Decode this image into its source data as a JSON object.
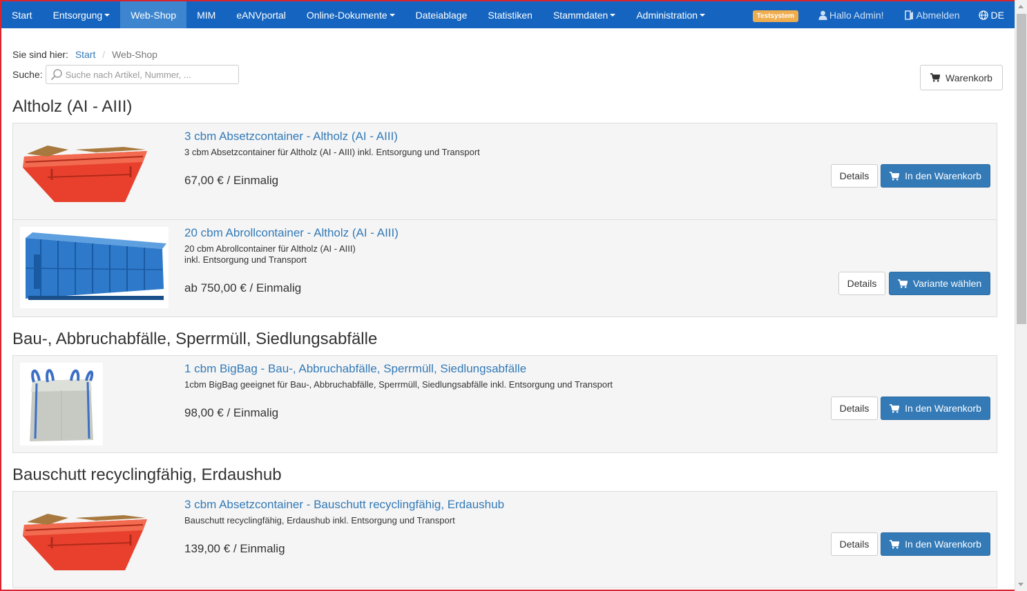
{
  "nav": {
    "items": [
      {
        "label": "Start",
        "dropdown": false,
        "active": false
      },
      {
        "label": "Entsorgung",
        "dropdown": true,
        "active": false
      },
      {
        "label": "Web-Shop",
        "dropdown": false,
        "active": true
      },
      {
        "label": "MIM",
        "dropdown": false,
        "active": false
      },
      {
        "label": "eANVportal",
        "dropdown": false,
        "active": false
      },
      {
        "label": "Online-Dokumente",
        "dropdown": true,
        "active": false
      },
      {
        "label": "Dateiablage",
        "dropdown": false,
        "active": false
      },
      {
        "label": "Statistiken",
        "dropdown": false,
        "active": false
      },
      {
        "label": "Stammdaten",
        "dropdown": true,
        "active": false
      },
      {
        "label": "Administration",
        "dropdown": true,
        "active": false
      }
    ],
    "badge": "Testsystem",
    "user": "Hallo Admin!",
    "logout": "Abmelden",
    "language": "DE"
  },
  "breadcrumb": {
    "prefix": "Sie sind hier:",
    "items": [
      "Start",
      "Web-Shop"
    ]
  },
  "search": {
    "label": "Suche:",
    "placeholder": "Suche nach Artikel, Nummer, ..."
  },
  "cart_button": "Warenkorb",
  "categories": [
    {
      "title": "Altholz (AI - AIII)",
      "products": [
        {
          "title": "3 cbm Absetzcontainer - Altholz (AI - AIII)",
          "desc": [
            "3 cbm Absetzcontainer für Altholz (AI - AIII) inkl. Entsorgung und Transport"
          ],
          "price": "67,00 € / Einmalig",
          "image": "red-skip-container",
          "details": "Details",
          "action": "In den Warenkorb"
        },
        {
          "title": "20 cbm Abrollcontainer - Altholz (AI - AIII)",
          "desc": [
            "20 cbm Abrollcontainer für Altholz (AI - AIII)",
            "inkl. Entsorgung und Transport"
          ],
          "price": "ab 750,00 € / Einmalig",
          "image": "blue-roll-off-container",
          "details": "Details",
          "action": "Variante wählen"
        }
      ]
    },
    {
      "title": "Bau-, Abbruchabfälle, Sperrmüll, Siedlungsabfälle",
      "products": [
        {
          "title": "1 cbm BigBag - Bau-, Abbruchabfälle, Sperrmüll, Siedlungsabfälle",
          "desc": [
            "1cbm BigBag geeignet für Bau-, Abbruchabfälle, Sperrmüll, Siedlungsabfälle inkl. Entsorgung und Transport"
          ],
          "price": "98,00 € / Einmalig",
          "image": "big-bag",
          "details": "Details",
          "action": "In den Warenkorb"
        }
      ]
    },
    {
      "title": "Bauschutt recyclingfähig, Erdaushub",
      "products": [
        {
          "title": "3 cbm Absetzcontainer - Bauschutt recyclingfähig, Erdaushub",
          "desc": [
            "Bauschutt recyclingfähig, Erdaushub inkl. Entsorgung und Transport"
          ],
          "price": "139,00 € / Einmalig",
          "image": "red-skip-container",
          "details": "Details",
          "action": "In den Warenkorb"
        }
      ]
    }
  ],
  "colors": {
    "navbar": "#1565c0",
    "nav_active": "#3d86cf",
    "primary": "#337ab7",
    "link": "#337ab7",
    "badge": "#f0ad4e",
    "frame": "#d9232d"
  }
}
